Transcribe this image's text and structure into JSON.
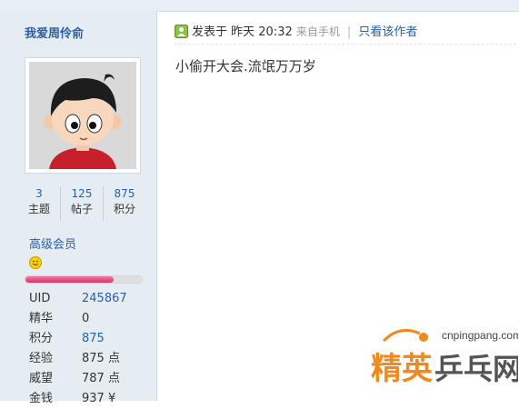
{
  "profile": {
    "username": "我爱周伶俞",
    "stats": [
      {
        "value": "3",
        "label": "主题"
      },
      {
        "value": "125",
        "label": "帖子"
      },
      {
        "value": "875",
        "label": "积分"
      }
    ],
    "rank": "高级会员",
    "level_progress": 0.76,
    "info": [
      {
        "key": "UID",
        "value": "245867"
      },
      {
        "key": "精华",
        "value": "0"
      },
      {
        "key": "积分",
        "value": "875"
      },
      {
        "key": "经验",
        "value": "875 点"
      },
      {
        "key": "威望",
        "value": "787 点"
      },
      {
        "key": "金钱",
        "value": "937 ¥"
      }
    ]
  },
  "post": {
    "posted_label": "发表于",
    "time": "昨天 20:32",
    "source": "来自手机",
    "author_only": "只看该作者",
    "content": "小偷开大会.流氓万万岁"
  },
  "watermark": {
    "url": "cnpingpang.com",
    "brand_a": "精英",
    "brand_b": "乒乓网"
  },
  "colors": {
    "link": "#2b5ea8",
    "sidebar_bg": "#e5edf2",
    "level_bar": "#e0457c",
    "watermark_orange": "#f08a1d"
  }
}
